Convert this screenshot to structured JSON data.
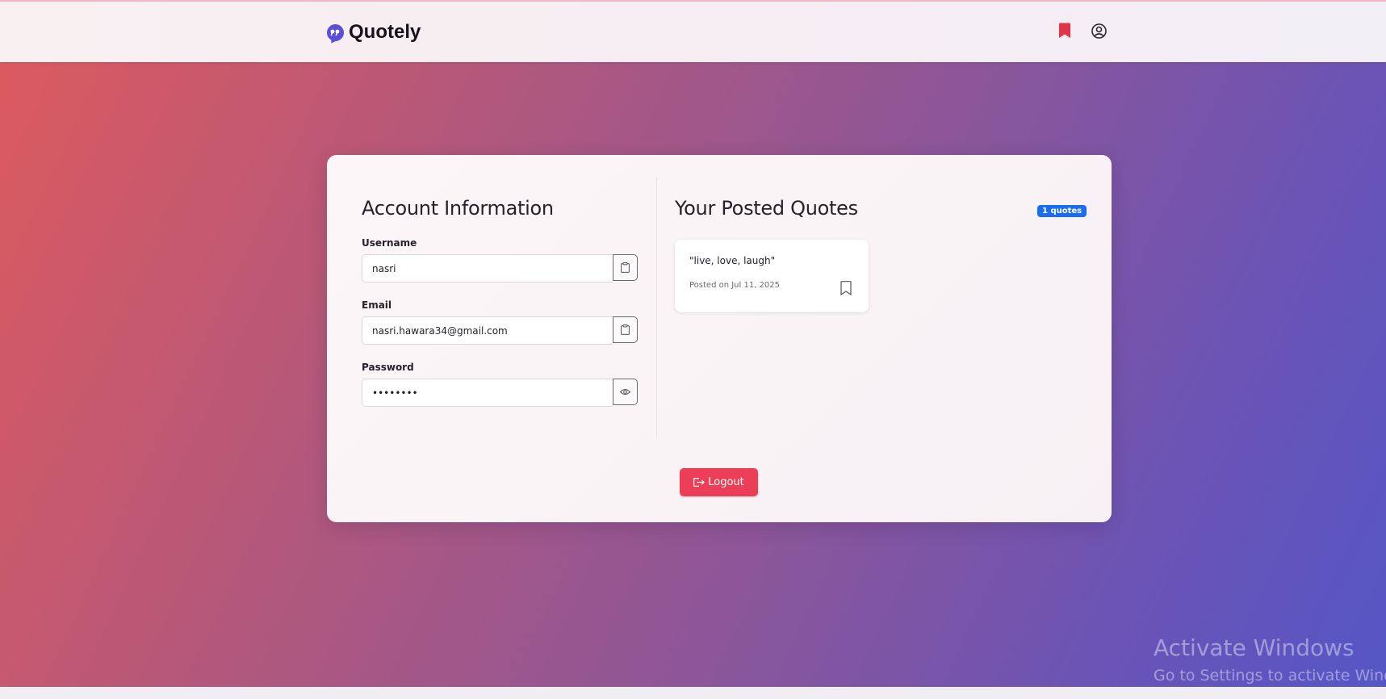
{
  "app": {
    "name": "Quotely"
  },
  "account": {
    "title": "Account Information",
    "username_label": "Username",
    "username_value": "nasri",
    "email_label": "Email",
    "email_value": "nasri.hawara34@gmail.com",
    "password_label": "Password",
    "password_value": "••••••••"
  },
  "quotes": {
    "title": "Your Posted Quotes",
    "count_badge": "1 quotes",
    "items": [
      {
        "text": "\"live, love, laugh\"",
        "date": "Posted on Jul 11, 2025"
      }
    ]
  },
  "logout_label": "Logout",
  "watermark": {
    "title": "Activate Windows",
    "subtitle": "Go to Settings to activate Windows."
  },
  "colors": {
    "accent": "#5b4fd6",
    "bookmark": "#e0344a",
    "logout": "#ec3f57",
    "badge": "#1a6cf2"
  },
  "icons": {
    "brand": "quote-bubble-icon",
    "nav_bookmark": "bookmark-filled-icon",
    "nav_user": "user-circle-icon",
    "copy": "clipboard-icon",
    "show_password": "eye-icon",
    "quote_bookmark": "bookmark-outline-icon",
    "logout": "logout-icon"
  }
}
